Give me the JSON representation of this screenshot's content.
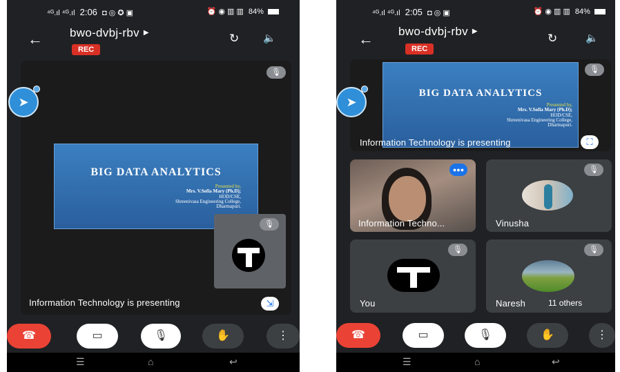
{
  "left_phone": {
    "status": {
      "signal": "⁴ᴳ.ıl ⁴ᴳ.ıl",
      "time": "2:06",
      "right_icons": "◘ ⦿ ᵛᵒˡᵗᵉ",
      "battery": "84%"
    },
    "meeting_name": "bwo-dvbj-rbv",
    "rec_label": "REC",
    "presenting_caption": "Information Technology is presenting",
    "slide": {
      "title": "BIG DATA ANALYTICS",
      "presented_by": "Presented by,",
      "presenter": "Mrs. V.Sofia Mary (Ph.D);",
      "role": "HOD/CSE,",
      "college": "Shreenivasa Engineering College,",
      "place": "Dharmapuri."
    }
  },
  "right_phone": {
    "status": {
      "signal": "⁴ᴳ.ıl ⁴ᴳ.ıl",
      "time": "2:05",
      "right_icons": "◘ ⦿ ᵛᵒˡᵗᵉ",
      "battery": "84%"
    },
    "meeting_name": "bwo-dvbj-rbv",
    "rec_label": "REC",
    "presenting_caption": "Information Technology is presenting",
    "slide": {
      "title": "BIG DATA ANALYTICS",
      "presented_by": "Presented by,",
      "presenter": "Mrs. V.Sofia Mary (Ph.D);",
      "role": "HOD/CSE,",
      "college": "Shreenivasa Engineering College,",
      "place": "Dharmapuri."
    },
    "participants": [
      {
        "name": "Information Techno..."
      },
      {
        "name": "Vinusha"
      },
      {
        "name": "You"
      },
      {
        "name": "Naresh"
      }
    ],
    "others_label": "11 others"
  },
  "icons": {
    "back": "←",
    "caret": "▶",
    "switch_camera": "↻",
    "speaker": "🔈",
    "mic_off": "🎙",
    "end_call": "☎",
    "camera_off": "▭",
    "raise_hand": "✋",
    "more": "⋮",
    "nav_menu": "☰",
    "nav_home": "⌂",
    "nav_back": "↩",
    "telegram": "➤"
  },
  "colors": {
    "end_call": "#ea4335",
    "rec": "#d93025",
    "accent": "#1a73e8",
    "tile": "#3c4043"
  }
}
